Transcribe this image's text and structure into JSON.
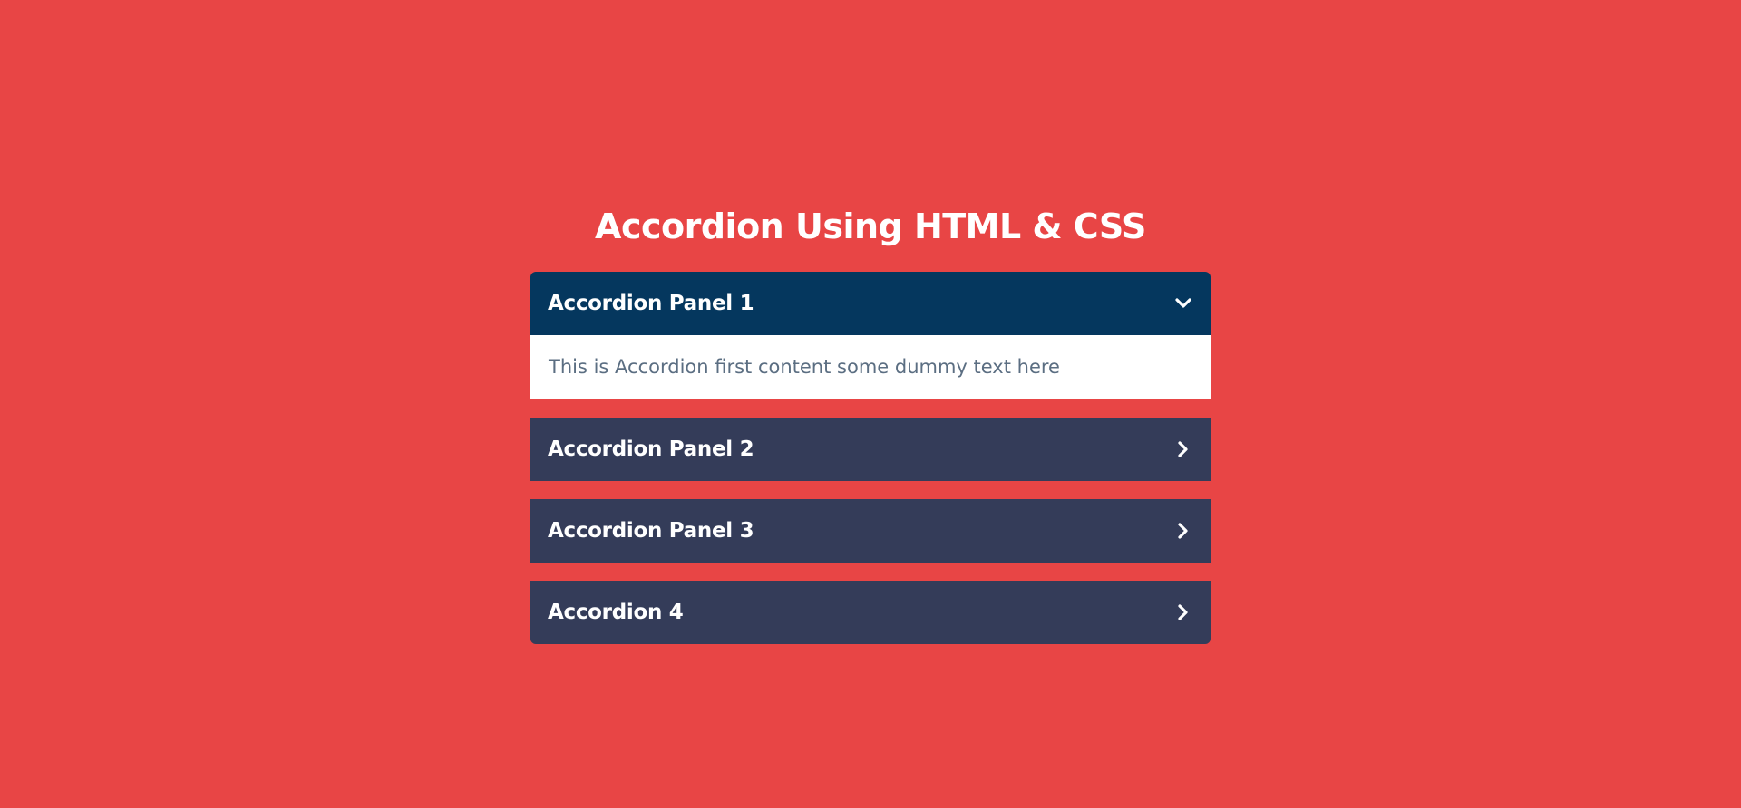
{
  "page": {
    "title": "Accordion Using HTML & CSS",
    "background_color": "#e84545"
  },
  "accordion": {
    "active_header_color": "#05375e",
    "header_color": "#343c59",
    "panels": [
      {
        "label": "Accordion Panel 1",
        "expanded": true,
        "icon": "chevron-down-icon",
        "content": "This is Accordion first content some dummy text here"
      },
      {
        "label": "Accordion Panel 2",
        "expanded": false,
        "icon": "chevron-right-icon"
      },
      {
        "label": "Accordion Panel 3",
        "expanded": false,
        "icon": "chevron-right-icon"
      },
      {
        "label": "Accordion 4",
        "expanded": false,
        "icon": "chevron-right-icon"
      }
    ]
  }
}
